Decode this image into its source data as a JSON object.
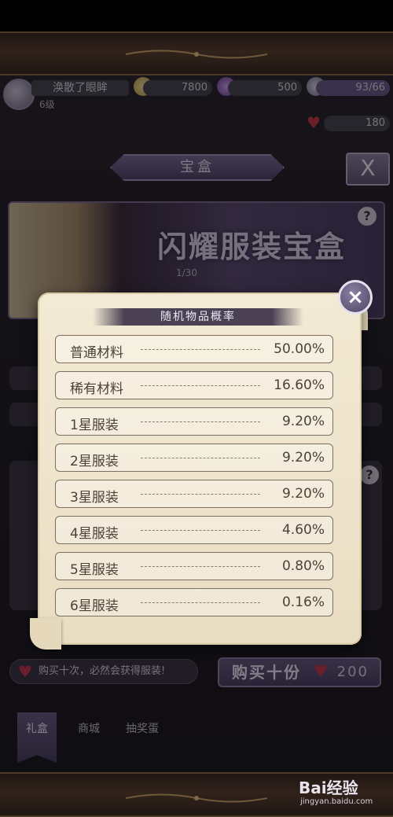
{
  "player": {
    "name": "涣散了眼眸",
    "level": "6级"
  },
  "resources": {
    "gold": "7800",
    "gems": "500",
    "stamina": "93/66",
    "hearts": "180"
  },
  "box": {
    "tab_label": "宝盒",
    "close_label": "X",
    "banner_title": "闪耀服装宝盒",
    "help_label": "?",
    "progress": "1/30"
  },
  "bottom": {
    "promo_text": "购买十次，必然会获得服装!",
    "buy10_label": "购买十份",
    "buy10_cost": "200"
  },
  "tabs": [
    {
      "label": "礼盒",
      "active": true
    },
    {
      "label": "商城",
      "active": false
    },
    {
      "label": "抽奖蛋",
      "active": false
    }
  ],
  "modal": {
    "title": "随机物品概率",
    "close_label": "×",
    "rows": [
      {
        "name": "普通材料",
        "value": "50.00%"
      },
      {
        "name": "稀有材料",
        "value": "16.60%"
      },
      {
        "name": "1星服装",
        "value": "9.20%"
      },
      {
        "name": "2星服装",
        "value": "9.20%"
      },
      {
        "name": "3星服装",
        "value": "9.20%"
      },
      {
        "name": "4星服装",
        "value": "4.60%"
      },
      {
        "name": "5星服装",
        "value": "0.80%"
      },
      {
        "name": "6星服装",
        "value": "0.16%"
      }
    ]
  },
  "watermark": {
    "main": "Bai经验",
    "sub": "jingyan.baidu.com"
  },
  "colors": {
    "accent": "#5b4c78",
    "heart": "#c43a4e",
    "parchment": "#efe4cc"
  }
}
